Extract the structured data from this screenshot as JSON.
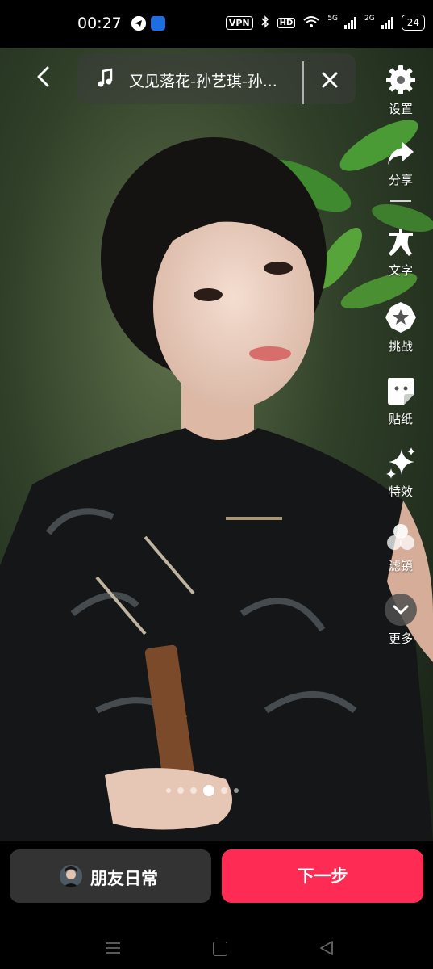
{
  "status_bar": {
    "time": "00:27",
    "vpn": "VPN",
    "hd": "HD",
    "net1": "5G",
    "net2": "2G",
    "battery": "24"
  },
  "music": {
    "title": "又见落花-孙艺琪-孙..."
  },
  "toolbar": {
    "items": [
      {
        "label": "设置",
        "icon": "gear-icon"
      },
      {
        "label": "分享",
        "icon": "share-icon"
      },
      {
        "label": "文字",
        "icon": "text-icon"
      },
      {
        "label": "挑战",
        "icon": "challenge-icon"
      },
      {
        "label": "贴纸",
        "icon": "sticker-icon"
      },
      {
        "label": "特效",
        "icon": "sparkle-icon"
      },
      {
        "label": "滤镜",
        "icon": "filter-icon"
      },
      {
        "label": "更多",
        "icon": "more-icon"
      }
    ]
  },
  "pager": {
    "count": 6,
    "active": 3
  },
  "bottom": {
    "friends_label": "朋友日常",
    "next_label": "下一步"
  },
  "colors": {
    "accent": "#fe2c55",
    "button_dark": "#333333"
  }
}
